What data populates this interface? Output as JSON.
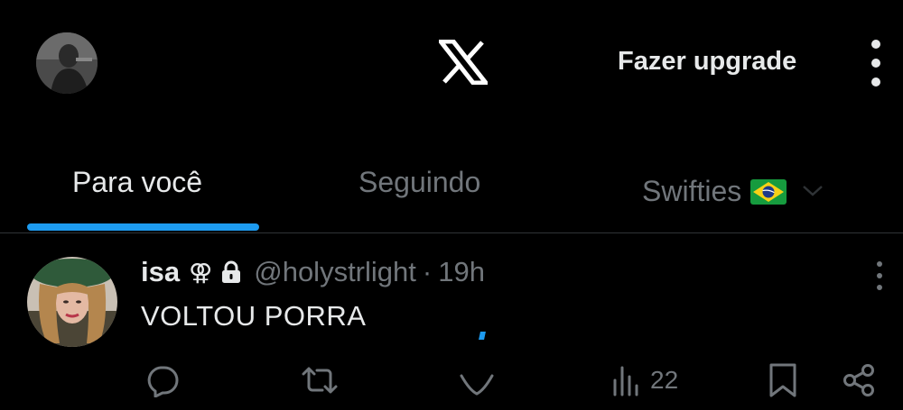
{
  "header": {
    "upgrade_label": "Fazer upgrade",
    "logo_icon": "x-logo-icon",
    "more_icon": "more-vertical-icon"
  },
  "tabs": [
    {
      "label": "Para você",
      "active": true
    },
    {
      "label": "Seguindo",
      "active": false
    },
    {
      "label": "Swifties",
      "active": false,
      "flag_icon": "brazil-flag-icon"
    }
  ],
  "post": {
    "name": "isa",
    "name_symbol": "⚢",
    "protected_icon": "lock-icon",
    "handle": "@holystrlight",
    "separator": "·",
    "time": "19h",
    "text": "VOLTOU PORRA",
    "views": "22"
  },
  "colors": {
    "background": "#000000",
    "accent": "#1d9bf0",
    "text_primary": "#e7e9ea",
    "text_secondary": "#71767b",
    "divider": "#2f3336"
  }
}
